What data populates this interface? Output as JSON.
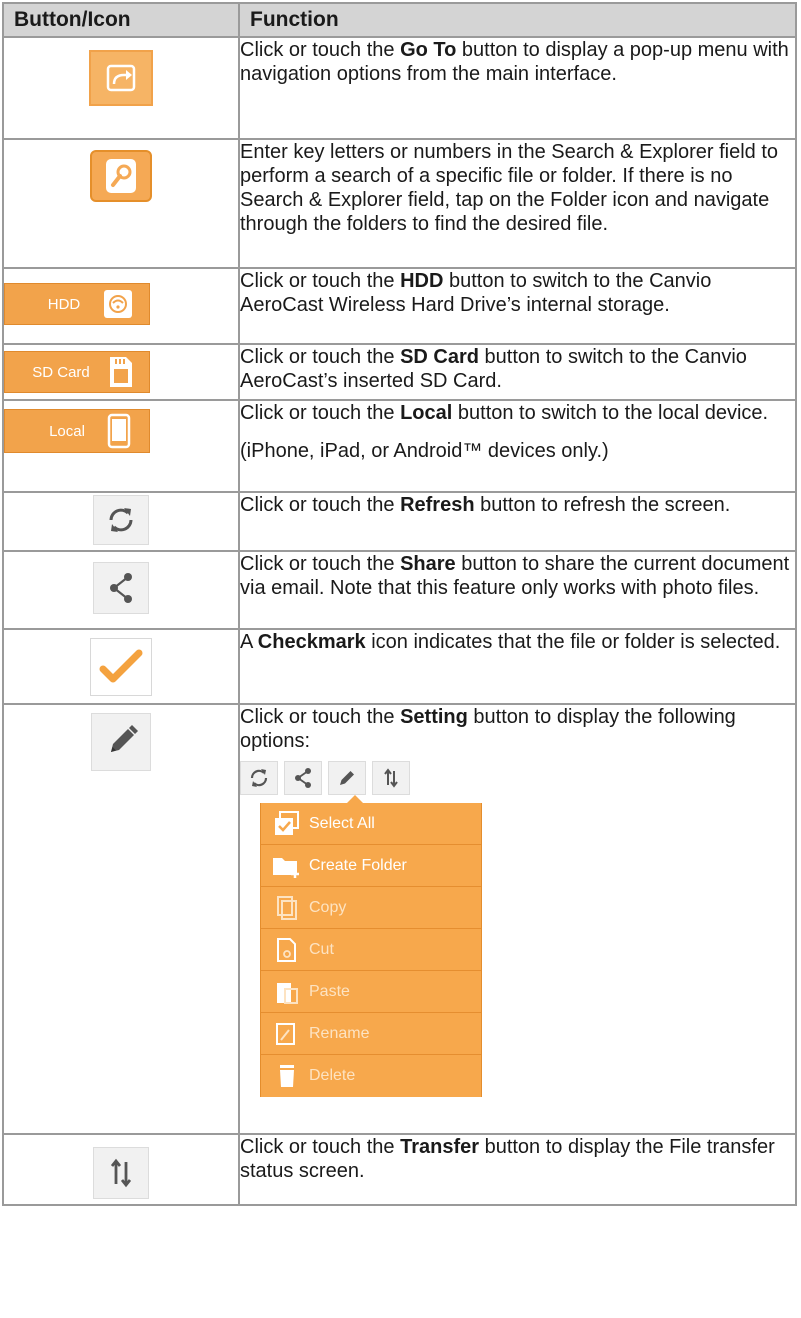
{
  "table": {
    "headers": [
      "Button/Icon",
      "Function"
    ],
    "rows": [
      {
        "icon": "go-to-icon",
        "desc": [
          [
            "Click or touch the ",
            false
          ],
          [
            "Go To",
            true
          ],
          [
            " button to display a pop-up menu with navigation options from the main interface.",
            false
          ]
        ]
      },
      {
        "icon": "search-icon",
        "desc": [
          [
            "Enter key letters or numbers in the Search & Explorer field to perform a search of a specific file or folder. If there is no Search & Explorer field, tap on the Folder icon and navigate through the folders to find the desired file.",
            false
          ]
        ]
      },
      {
        "icon": "hdd-icon",
        "button_label": "HDD",
        "desc": [
          [
            "Click or touch the ",
            false
          ],
          [
            "HDD",
            true
          ],
          [
            " button to switch to the Canvio AeroCast Wireless Hard Drive’s internal storage.",
            false
          ]
        ]
      },
      {
        "icon": "sd-card-icon",
        "button_label": "SD Card",
        "desc": [
          [
            "Click or touch the ",
            false
          ],
          [
            "SD Card",
            true
          ],
          [
            " button to switch to the Canvio AeroCast’s inserted SD Card.",
            false
          ]
        ]
      },
      {
        "icon": "phone-icon",
        "button_label": "Local",
        "desc": [
          [
            "Click or touch the ",
            false
          ],
          [
            "Local",
            true
          ],
          [
            " button to switch to the local device.",
            false
          ]
        ],
        "note": "(iPhone, iPad, or Android™ devices only.)"
      },
      {
        "icon": "refresh-icon",
        "desc": [
          [
            "Click or touch the ",
            false
          ],
          [
            "Refresh",
            true
          ],
          [
            " button to refresh the screen.",
            false
          ]
        ]
      },
      {
        "icon": "share-icon",
        "desc": [
          [
            "Click or touch the ",
            false
          ],
          [
            "Share",
            true
          ],
          [
            " button to share the current document via email. Note that this feature only works with photo files.",
            false
          ]
        ]
      },
      {
        "icon": "checkmark-icon",
        "desc": [
          [
            "A ",
            false
          ],
          [
            "Checkmark",
            true
          ],
          [
            " icon indicates that the file or folder is selected.",
            false
          ]
        ]
      },
      {
        "icon": "pencil-icon",
        "desc": [
          [
            "Click or touch the ",
            false
          ],
          [
            "Setting",
            true
          ],
          [
            " button to display the following options:",
            false
          ]
        ],
        "menu": {
          "toolbar": [
            "refresh-icon",
            "share-icon",
            "pencil-icon",
            "transfer-icon"
          ],
          "items": [
            {
              "label": "Select All",
              "icon": "select-all-icon",
              "enabled": true
            },
            {
              "label": "Create Folder",
              "icon": "create-folder-icon",
              "enabled": true
            },
            {
              "label": "Copy",
              "icon": "copy-icon",
              "enabled": false
            },
            {
              "label": "Cut",
              "icon": "cut-icon",
              "enabled": false
            },
            {
              "label": "Paste",
              "icon": "paste-icon",
              "enabled": false
            },
            {
              "label": "Rename",
              "icon": "rename-icon",
              "enabled": false
            },
            {
              "label": "Delete",
              "icon": "delete-icon",
              "enabled": false
            }
          ]
        }
      },
      {
        "icon": "transfer-icon",
        "desc": [
          [
            "Click or touch the ",
            false
          ],
          [
            "Transfer",
            true
          ],
          [
            " button to display the File transfer status screen.",
            false
          ]
        ]
      }
    ]
  },
  "colors": {
    "orange": "#f2a34b",
    "header_bg": "#d4d4d4",
    "border": "#9a9a9a",
    "icon_gray": "#555555"
  }
}
